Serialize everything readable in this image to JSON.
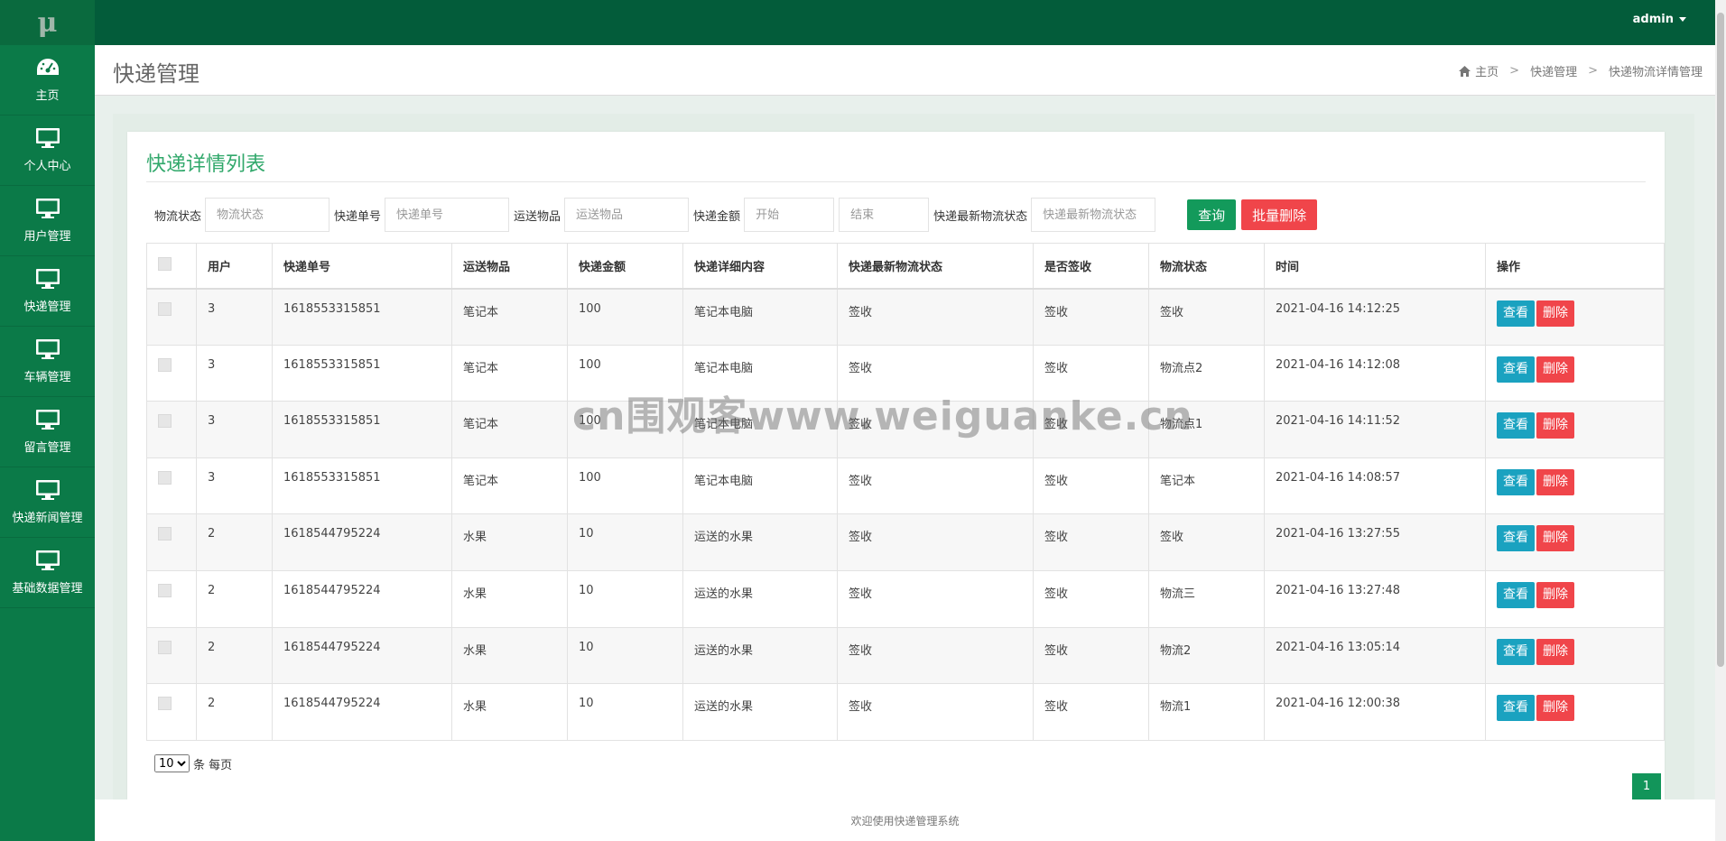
{
  "app": {
    "logo": "μ"
  },
  "sidebar": {
    "items": [
      {
        "label": "主页",
        "icon": "dashboard-icon"
      },
      {
        "label": "个人中心",
        "icon": "monitor-icon"
      },
      {
        "label": "用户管理",
        "icon": "monitor-icon"
      },
      {
        "label": "快递管理",
        "icon": "monitor-icon"
      },
      {
        "label": "车辆管理",
        "icon": "monitor-icon"
      },
      {
        "label": "留言管理",
        "icon": "monitor-icon"
      },
      {
        "label": "快递新闻管理",
        "icon": "monitor-icon"
      },
      {
        "label": "基础数据管理",
        "icon": "monitor-icon"
      }
    ]
  },
  "topbar": {
    "user": "admin"
  },
  "header": {
    "title": "快递管理",
    "breadcrumb": [
      "主页",
      "快递管理",
      "快递物流详情管理"
    ]
  },
  "panel": {
    "title": "快递详情列表"
  },
  "search": {
    "fields": [
      {
        "label": "物流状态",
        "placeholder": "物流状态"
      },
      {
        "label": "快递单号",
        "placeholder": "快递单号"
      },
      {
        "label": "运送物品",
        "placeholder": "运送物品"
      },
      {
        "label": "快递金额",
        "placeholder_start": "开始",
        "placeholder_end": "结束"
      },
      {
        "label": "快递最新物流状态",
        "placeholder": "快递最新物流状态"
      }
    ],
    "query_label": "查询",
    "batch_delete_label": "批量删除"
  },
  "table": {
    "columns": [
      "用户",
      "快递单号",
      "运送物品",
      "快递金额",
      "快递详细内容",
      "快递最新物流状态",
      "是否签收",
      "物流状态",
      "时间",
      "操作"
    ],
    "view_label": "查看",
    "delete_label": "删除",
    "rows": [
      {
        "user": "3",
        "no": "1618553315851",
        "item": "笔记本",
        "amount": "100",
        "detail": "笔记本电脑",
        "latest": "签收",
        "signed": "签收",
        "status": "签收",
        "time": "2021-04-16 14:12:25"
      },
      {
        "user": "3",
        "no": "1618553315851",
        "item": "笔记本",
        "amount": "100",
        "detail": "笔记本电脑",
        "latest": "签收",
        "signed": "签收",
        "status": "物流点2",
        "time": "2021-04-16 14:12:08"
      },
      {
        "user": "3",
        "no": "1618553315851",
        "item": "笔记本",
        "amount": "100",
        "detail": "笔记本电脑",
        "latest": "签收",
        "signed": "签收",
        "status": "物流点1",
        "time": "2021-04-16 14:11:52"
      },
      {
        "user": "3",
        "no": "1618553315851",
        "item": "笔记本",
        "amount": "100",
        "detail": "笔记本电脑",
        "latest": "签收",
        "signed": "签收",
        "status": "笔记本",
        "time": "2021-04-16 14:08:57"
      },
      {
        "user": "2",
        "no": "1618544795224",
        "item": "水果",
        "amount": "10",
        "detail": "运送的水果",
        "latest": "签收",
        "signed": "签收",
        "status": "签收",
        "time": "2021-04-16 13:27:55"
      },
      {
        "user": "2",
        "no": "1618544795224",
        "item": "水果",
        "amount": "10",
        "detail": "运送的水果",
        "latest": "签收",
        "signed": "签收",
        "status": "物流三",
        "time": "2021-04-16 13:27:48"
      },
      {
        "user": "2",
        "no": "1618544795224",
        "item": "水果",
        "amount": "10",
        "detail": "运送的水果",
        "latest": "签收",
        "signed": "签收",
        "status": "物流2",
        "time": "2021-04-16 13:05:14"
      },
      {
        "user": "2",
        "no": "1618544795224",
        "item": "水果",
        "amount": "10",
        "detail": "运送的水果",
        "latest": "签收",
        "signed": "签收",
        "status": "物流1",
        "time": "2021-04-16 12:00:38"
      }
    ]
  },
  "pagination": {
    "page_size": "10",
    "page_size_suffix": "条 每页",
    "current_page": "1"
  },
  "footer": {
    "text": "欢迎使用快递管理系统"
  },
  "watermark": "cn围观客www.weiguanke.cn"
}
